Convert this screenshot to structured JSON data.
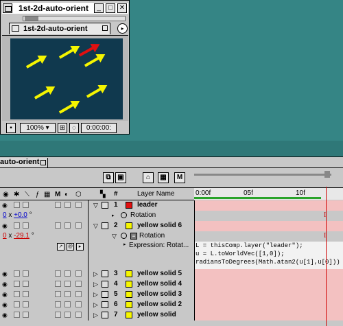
{
  "comp_window": {
    "title": "1st-2d-auto-orient",
    "tab_label": "1st-2d-auto-orient",
    "zoom": "100%",
    "timecode": "0:00:00:",
    "minimize_glyph": "_",
    "maximize_glyph": "□",
    "close_glyph": "✕",
    "menu_glyph": "▸"
  },
  "timeline": {
    "tab_label": "auto-orient",
    "header": {
      "layer_name_col": "Layer Name",
      "num_col": "#"
    },
    "ruler": {
      "labels": [
        "0:00f",
        "05f",
        "10f"
      ]
    },
    "controls": {
      "m_label": "M"
    },
    "layers": [
      {
        "num": "1",
        "name": "leader",
        "color": "#e01010",
        "expanded": true
      },
      {
        "num": "2",
        "name": "yellow solid 6",
        "color": "#f5f500",
        "expanded": true
      },
      {
        "num": "3",
        "name": "yellow solid 5",
        "color": "#f5f500",
        "expanded": false
      },
      {
        "num": "4",
        "name": "yellow solid 4",
        "color": "#f5f500",
        "expanded": false
      },
      {
        "num": "5",
        "name": "yellow solid 3",
        "color": "#f5f500",
        "expanded": false
      },
      {
        "num": "6",
        "name": "yellow solid 2",
        "color": "#f5f500",
        "expanded": false
      },
      {
        "num": "7",
        "name": "yellow solid",
        "color": "#f5f500",
        "expanded": false
      }
    ],
    "leader_rotation": {
      "label": "Rotation",
      "turns": "0",
      "degrees": "+0.0",
      "unit": "°"
    },
    "solid6_rotation": {
      "label": "Rotation",
      "turns": "0",
      "degrees": "-29.1",
      "unit": "°"
    },
    "expression": {
      "label": "Expression: Rotat...",
      "lines": [
        "L = thisComp.layer(\"leader\");",
        "u = L.toWorldVec([1,0]);",
        "radiansToDegrees(Math.atan2(u[1],u[0]))"
      ]
    },
    "ibeam_glyph": "I"
  }
}
